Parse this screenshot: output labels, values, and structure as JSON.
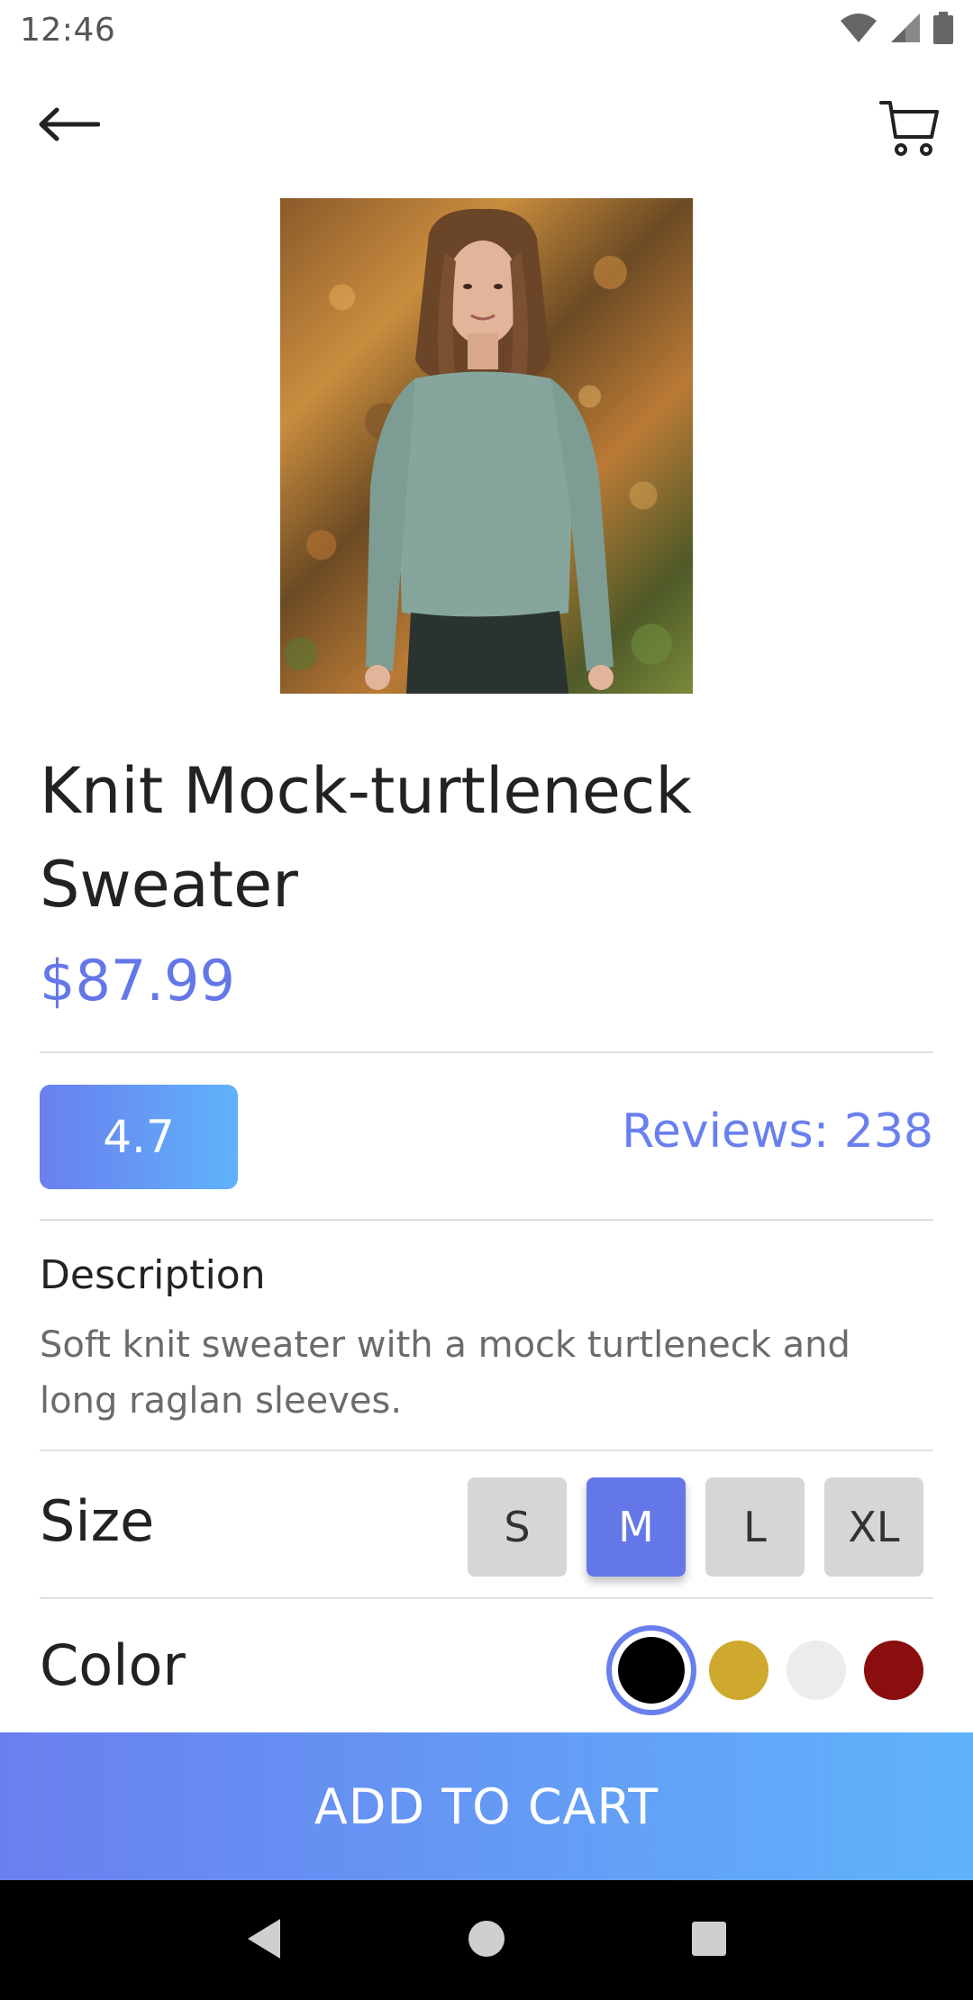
{
  "status_bar": {
    "time": "12:46",
    "icons": [
      "wifi-icon",
      "signal-icon",
      "battery-icon"
    ]
  },
  "app_bar": {
    "back_icon": "arrow-left-icon",
    "cart_icon": "cart-icon"
  },
  "product": {
    "title": "Knit Mock-turtleneck Sweater",
    "price": "$87.99",
    "rating": "4.7",
    "reviews_label": "Reviews: 238",
    "description_label": "Description",
    "description": "Soft knit sweater with a mock turtleneck and long raglan sleeves."
  },
  "size": {
    "label": "Size",
    "options": [
      "S",
      "M",
      "L",
      "XL"
    ],
    "selected": "M"
  },
  "color": {
    "label": "Color",
    "options": [
      "#000000",
      "#cfa92e",
      "#ececec",
      "#8a0e0e"
    ],
    "selected": "#000000"
  },
  "actions": {
    "add_to_cart": "ADD TO CART"
  },
  "nav": {
    "icons": [
      "back-triangle-icon",
      "home-circle-icon",
      "recents-square-icon"
    ]
  },
  "colors": {
    "accent": "#6477e8",
    "gradient_start": "#6a7fee",
    "gradient_end": "#5fb3fb"
  }
}
